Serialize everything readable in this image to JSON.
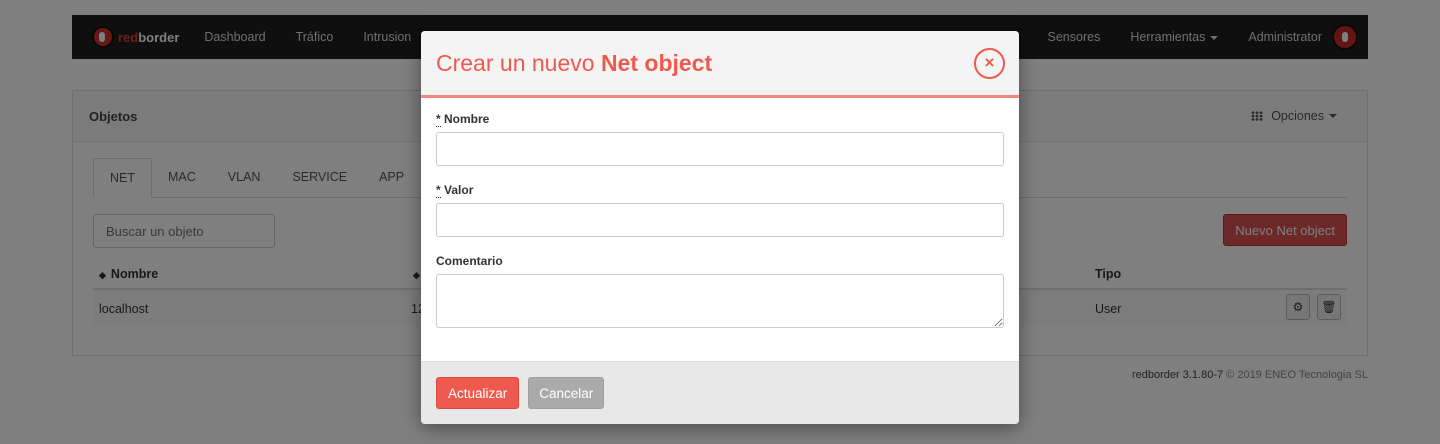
{
  "navbar": {
    "logo_red": "red",
    "logo_rest": "border",
    "items": [
      "Dashboard",
      "Tráfico",
      "Intrusion"
    ],
    "right_items": [
      "Sensores",
      "Herramientas",
      "Administrator"
    ]
  },
  "panel": {
    "title": "Objetos",
    "options_label": "Opciones",
    "tabs": [
      "NET",
      "MAC",
      "VLAN",
      "SERVICE",
      "APP"
    ],
    "search_placeholder": "Buscar un objeto",
    "new_button": "Nuevo Net object",
    "columns": {
      "name": "Nombre",
      "type": "Tipo"
    },
    "rows": [
      {
        "name": "localhost",
        "value_partial": "12",
        "type": "User"
      }
    ]
  },
  "footer": {
    "brand_version": "redborder 3.1.80-7",
    "copyright": "© 2019 ENEO Tecnologia SL"
  },
  "modal": {
    "title_prefix": "Crear un nuevo",
    "title_bold": "Net object",
    "close_symbol": "×",
    "fields": {
      "name_label": "Nombre",
      "value_label": "Valor",
      "comment_label": "Comentario",
      "required_mark": "*"
    },
    "update_button": "Actualizar",
    "cancel_button": "Cancelar"
  },
  "colors": {
    "accent": "#ef5a4f",
    "navbar": "#1e1e1e",
    "danger_button": "#d9534f"
  }
}
